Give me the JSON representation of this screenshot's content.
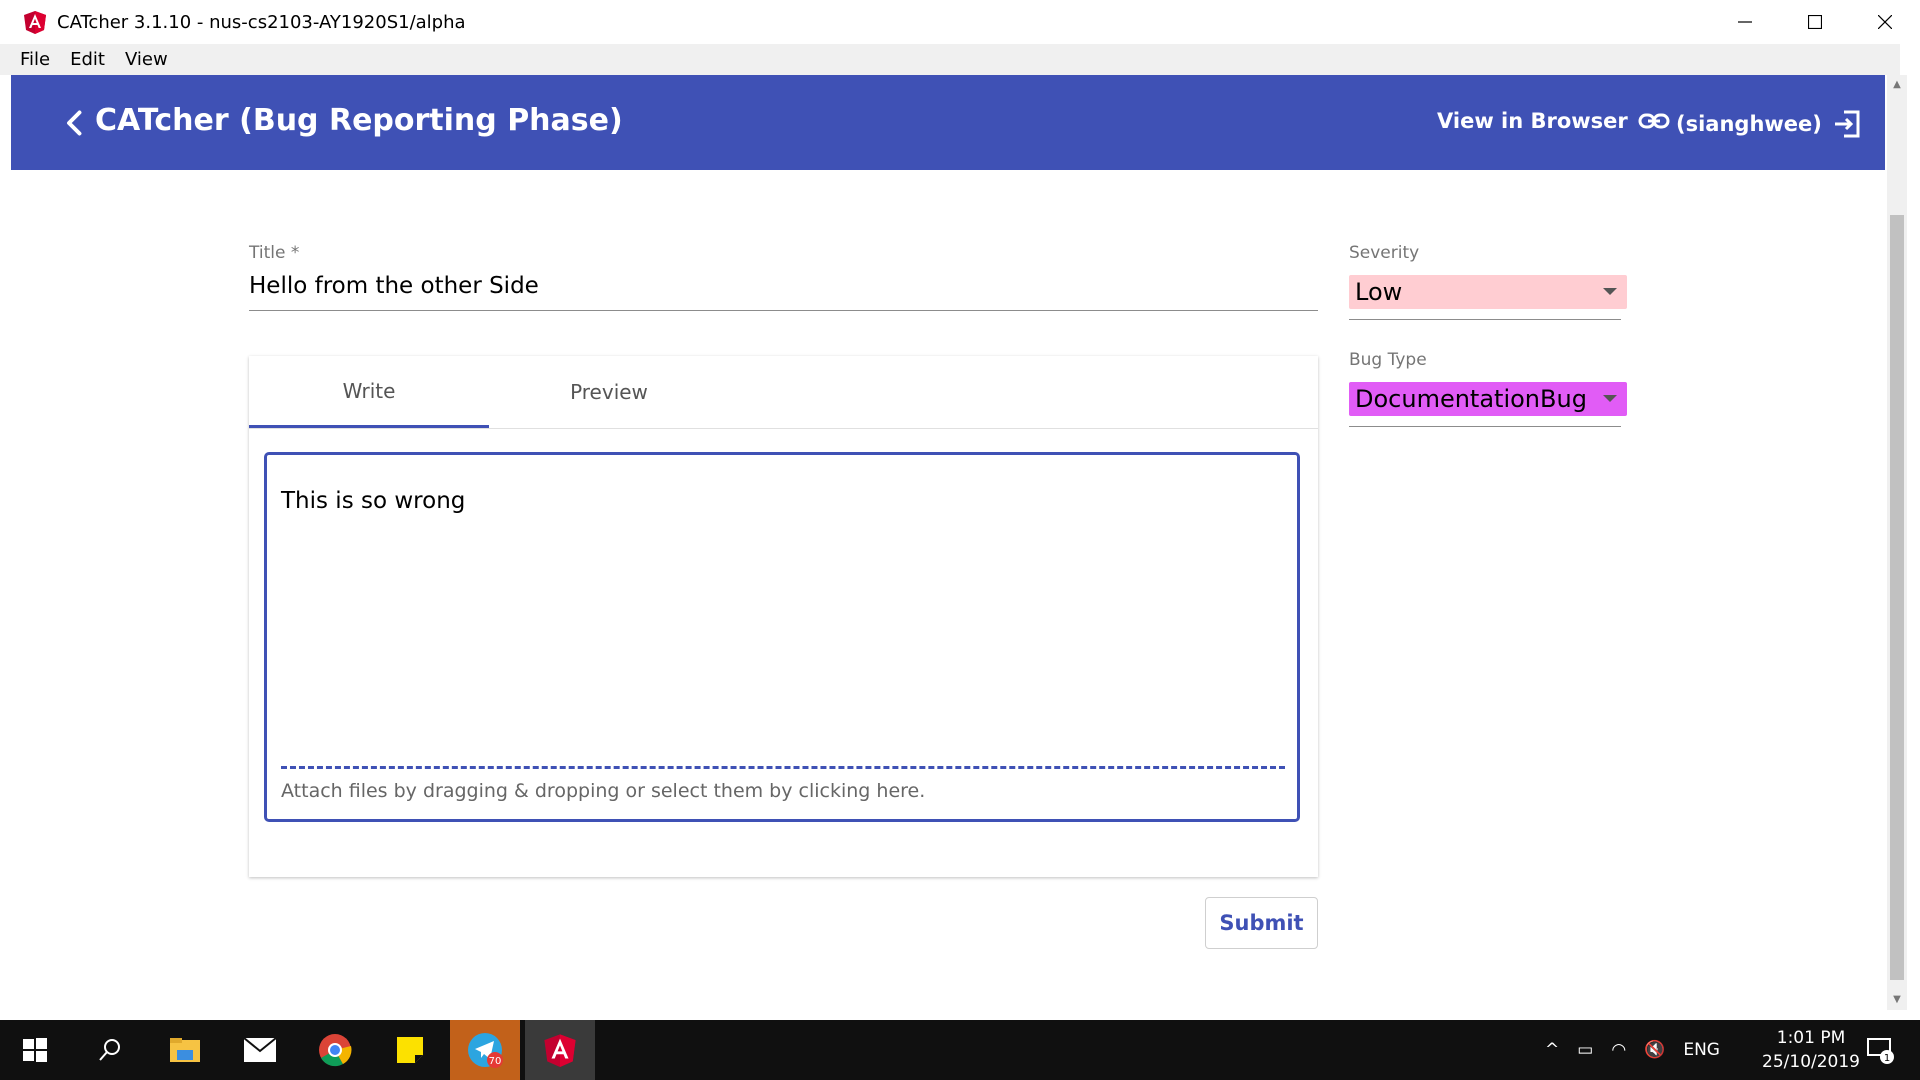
{
  "window": {
    "title": "CATcher 3.1.10 - nus-cs2103-AY1920S1/alpha",
    "menu": [
      "File",
      "Edit",
      "View"
    ]
  },
  "toolbar": {
    "title": "CATcher  (Bug Reporting Phase)",
    "view_in_browser": "View in Browser",
    "user": "(sianghwee)",
    "color": "#3f51b5"
  },
  "form": {
    "title_label": "Title *",
    "title_value": "Hello from the other Side",
    "severity": {
      "label": "Severity",
      "value": "Low",
      "color": "#ffcdd2"
    },
    "bug_type": {
      "label": "Bug Type",
      "value": "DocumentationBug",
      "color": "#e15cf6"
    },
    "tabs": [
      "Write",
      "Preview"
    ],
    "active_tab": "Write",
    "description": "This is so wrong",
    "attach_hint": "Attach files by dragging & dropping or select them by clicking here.",
    "submit_label": "Submit"
  },
  "taskbar": {
    "telegram_badge": "70",
    "tray": {
      "language": "ENG",
      "time": "1:01 PM",
      "date": "25/10/2019",
      "notifications": "1"
    }
  }
}
